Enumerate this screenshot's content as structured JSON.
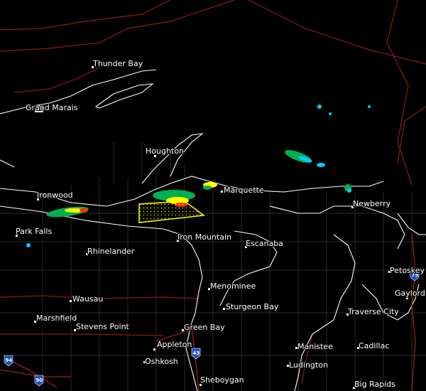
{
  "map": {
    "background": "#000000",
    "colors": {
      "state_border": "#8b1a1a",
      "county_border": "#3a3a3a",
      "coast": "#ffffff",
      "highway": "#9b1f1f",
      "warning_polygon": "#ffff00",
      "radar_light": "#00b050",
      "radar_mid": "#ffff00",
      "radar_heavy": "#ff3000"
    },
    "cities": [
      {
        "id": "thunder-bay",
        "name": "Thunder Bay"
      },
      {
        "id": "grand-marais",
        "name": "Grand Marais"
      },
      {
        "id": "houghton",
        "name": "Houghton"
      },
      {
        "id": "marquette",
        "name": "Marquette"
      },
      {
        "id": "ironwood",
        "name": "Ironwood"
      },
      {
        "id": "newberry",
        "name": "Newberry"
      },
      {
        "id": "park-falls",
        "name": "Park Falls"
      },
      {
        "id": "iron-mountain",
        "name": "Iron Mountain"
      },
      {
        "id": "escanaba",
        "name": "Escanaba"
      },
      {
        "id": "rhinelander",
        "name": "Rhinelander"
      },
      {
        "id": "petoskey",
        "name": "Petoskey"
      },
      {
        "id": "menominee",
        "name": "Menominee"
      },
      {
        "id": "gaylord",
        "name": "Gaylord"
      },
      {
        "id": "wausau",
        "name": "Wausau"
      },
      {
        "id": "sturgeon-bay",
        "name": "Sturgeon Bay"
      },
      {
        "id": "marshfield",
        "name": "Marshfield"
      },
      {
        "id": "traverse-city",
        "name": "Traverse City"
      },
      {
        "id": "stevens-point",
        "name": "Stevens Point"
      },
      {
        "id": "green-bay",
        "name": "Green Bay"
      },
      {
        "id": "appleton",
        "name": "Appleton"
      },
      {
        "id": "manistee",
        "name": "Manistee"
      },
      {
        "id": "cadillac",
        "name": "Cadillac"
      },
      {
        "id": "oshkosh",
        "name": "Oshkosh"
      },
      {
        "id": "ludington",
        "name": "Ludington"
      },
      {
        "id": "sheboygan",
        "name": "Sheboygan"
      },
      {
        "id": "big-rapids",
        "name": "Big Rapids"
      }
    ],
    "highway_shields": [
      {
        "id": "i75",
        "number": "75"
      },
      {
        "id": "i43",
        "number": "43"
      },
      {
        "id": "i94",
        "number": "94"
      },
      {
        "id": "i90",
        "number": "90"
      }
    ]
  }
}
